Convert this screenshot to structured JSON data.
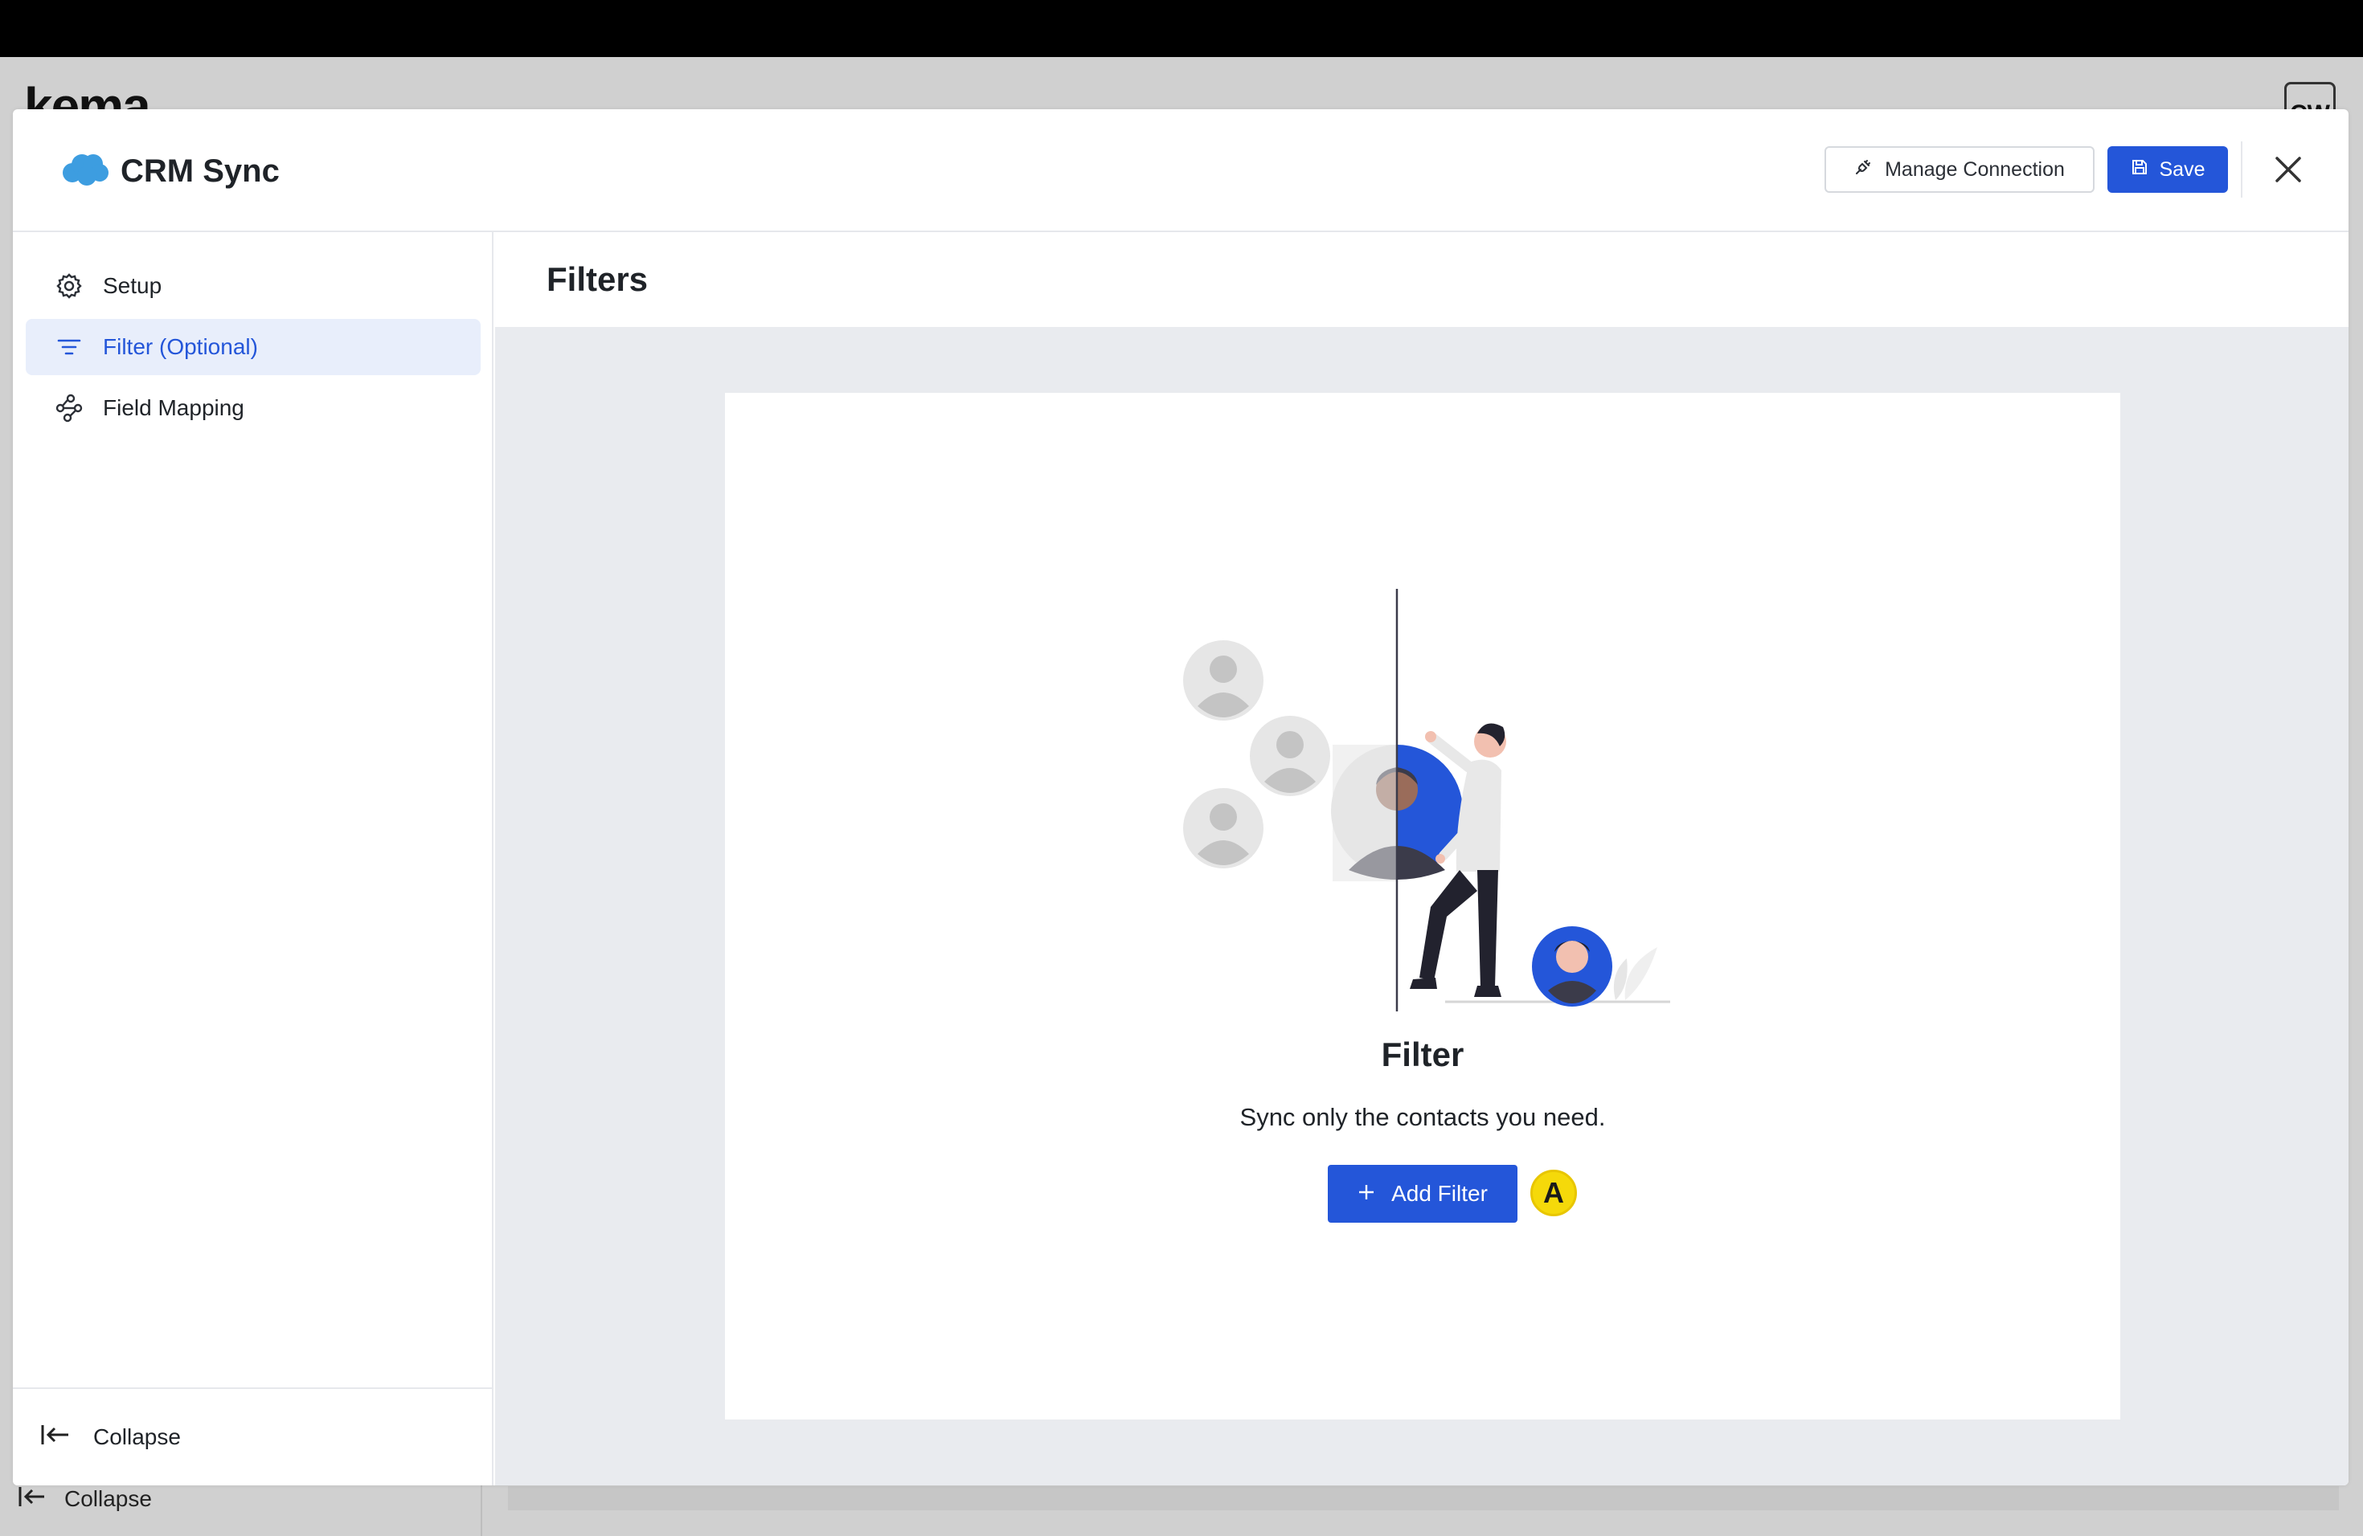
{
  "background_app": {
    "logo_text": "kema",
    "avatar_initials": "CW",
    "collapse_label": "Collapse"
  },
  "modal": {
    "brand": {
      "icon": "salesforce-cloud-icon",
      "title": "CRM Sync"
    },
    "header_actions": {
      "manage_connection_label": "Manage Connection",
      "manage_connection_icon": "plug-icon",
      "save_label": "Save",
      "save_icon": "floppy-disk-icon",
      "close_icon": "close-icon"
    },
    "sidebar": {
      "items": [
        {
          "label": "Setup",
          "icon": "gear-icon",
          "active": false
        },
        {
          "label": "Filter (Optional)",
          "icon": "filter-lines-icon",
          "active": true
        },
        {
          "label": "Field Mapping",
          "icon": "mapping-nodes-icon",
          "active": false
        }
      ],
      "collapse_label": "Collapse"
    },
    "main": {
      "page_title": "Filters",
      "empty_state": {
        "title": "Filter",
        "subtitle": "Sync only the contacts you need.",
        "add_button_label": "Add Filter",
        "marker_label": "A"
      }
    }
  },
  "colors": {
    "primary": "#2456d9",
    "active_bg": "#e8eefb",
    "main_bg": "#e9ebef",
    "marker": "#f5d90a"
  }
}
